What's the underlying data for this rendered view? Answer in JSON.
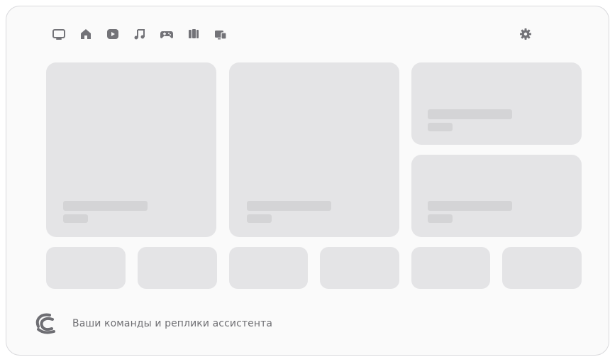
{
  "top_nav": {
    "icons": [
      "tv-icon",
      "home-icon",
      "play-icon",
      "music-icon",
      "gamepad-icon",
      "books-icon",
      "devices-icon"
    ]
  },
  "settings": {
    "icon": "gear-icon"
  },
  "assistant": {
    "logo": "assistant-logo-icon",
    "hint_text": "Ваши команды и реплики ассистента"
  },
  "colors": {
    "frame_bg": "#fafafa",
    "frame_border": "#d9d9dc",
    "card": "#e4e4e6",
    "placeholder": "#d4d4d6",
    "icon": "#737378",
    "text": "#6f6f73"
  }
}
